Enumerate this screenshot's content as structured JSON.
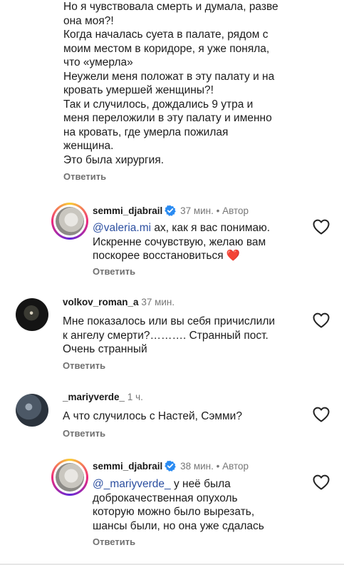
{
  "top_comment": {
    "lines": [
      "Но я чувствовала смерть и думала, разве",
      "она моя?!",
      "Когда началась суета в палате, рядом с",
      "моим местом в коридоре, я уже поняла,",
      "что «умерла»",
      "Неужели меня положат в эту палату и на",
      "кровать умершей женщины?!",
      "Так и случилось, дождались 9 утра и",
      "меня переложили в эту палату и именно",
      "на кровать, где умерла пожилая",
      "женщина.",
      "Это была хирургия."
    ],
    "reply_label": "Ответить"
  },
  "comments": [
    {
      "username": "semmi_djabrail",
      "verified": true,
      "time": "37 мин.",
      "author_tag": "Автор",
      "mention": "@valeria.mi",
      "lines": [
        " ах, как я вас понимаю.",
        "Искренне сочувствую, желаю вам",
        "поскорее восстановиться ❤️"
      ],
      "reply_label": "Ответить"
    },
    {
      "username": "volkov_roman_a",
      "time": "37 мин.",
      "lines": [
        "Мне показалось или вы себя причислили",
        "к ангелу смерти?………. Странный пост.",
        "Очень странный"
      ],
      "reply_label": "Ответить"
    },
    {
      "username": "_mariyverde_",
      "time": "1 ч.",
      "lines": [
        "А что случилось с Настей, Сэмми?"
      ],
      "reply_label": "Ответить"
    },
    {
      "username": "semmi_djabrail",
      "verified": true,
      "time": "38 мин.",
      "author_tag": "Автор",
      "mention": "@_mariyverde_",
      "lines": [
        " у неё была",
        "доброкачественная опухоль",
        "которую можно было вырезать,",
        "шансы были, но она уже сдалась"
      ],
      "reply_label": "Ответить"
    }
  ],
  "colors": {
    "mention": "#2c4fa0",
    "verified_badge": "#2a8bf2",
    "heart_emoji": "#e0245e"
  },
  "icons": {
    "like": "heart-outline-icon",
    "verified": "verified-badge-icon"
  }
}
